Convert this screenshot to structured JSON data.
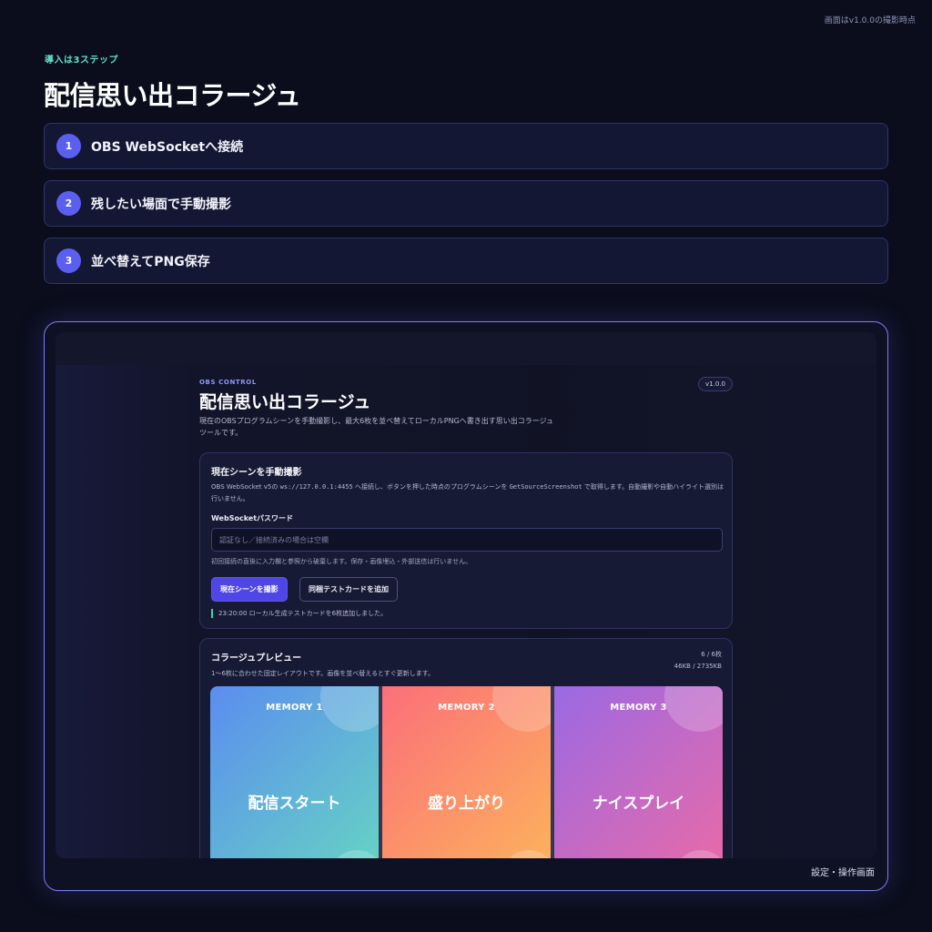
{
  "page": {
    "version_note": "画面はv1.0.0の撮影時点",
    "eyebrow": "導入は3ステップ",
    "title": "配信思い出コラージュ"
  },
  "steps": [
    {
      "number": "1",
      "label": "OBS WebSocketへ接続"
    },
    {
      "number": "2",
      "label": "残したい場面で手動撮影"
    },
    {
      "number": "3",
      "label": "並べ替えてPNG保存"
    }
  ],
  "screenshot": {
    "caption": "設定・操作画面",
    "app": {
      "eyebrow": "OBS CONTROL",
      "version": "v1.0.0",
      "title": "配信思い出コラージュ",
      "description": "現在のOBSプログラムシーンを手動撮影し、最大6枚を並べ替えてローカルPNGへ書き出す思い出コラージュツールです。",
      "capture_card": {
        "title": "現在シーンを手動撮影",
        "desc_prefix": "OBS WebSocket v5の ",
        "desc_url": "ws://127.0.0.1:4455",
        "desc_middle": " へ接続し、ボタンを押した時点のプログラムシーンを ",
        "desc_api": "GetSourceScreenshot",
        "desc_suffix": " で取得します。自動撮影や自動ハイライト選別は行いません。",
        "password_label": "WebSocketパスワード",
        "password_placeholder": "認証なし／接続済みの場合は空欄",
        "password_value": "",
        "hint": "初回接続の直後に入力欄と参照から破棄します。保存・画像埋込・外部送信は行いません。",
        "capture_button": "現在シーンを撮影",
        "test_button": "同梱テストカードを追加",
        "status": "23:20:00 ローカル生成テストカードを6枚追加しました。"
      },
      "preview_card": {
        "title": "コラージュプレビュー",
        "description": "1〜6枚に合わせた固定レイアウトです。画像を並べ替えるとすぐ更新します。",
        "count": "6 / 6枚",
        "size": "46KB / 2735KB",
        "tiles": [
          {
            "label": "MEMORY 1",
            "caption": "配信スタート",
            "color_from": "#5b8def",
            "color_to": "#66d3c4"
          },
          {
            "label": "MEMORY 2",
            "caption": "盛り上がり",
            "color_from": "#fb6f7a",
            "color_to": "#fcb25c"
          },
          {
            "label": "MEMORY 3",
            "caption": "ナイスプレイ",
            "color_from": "#9b69e4",
            "color_to": "#e86aa8"
          }
        ]
      }
    }
  }
}
